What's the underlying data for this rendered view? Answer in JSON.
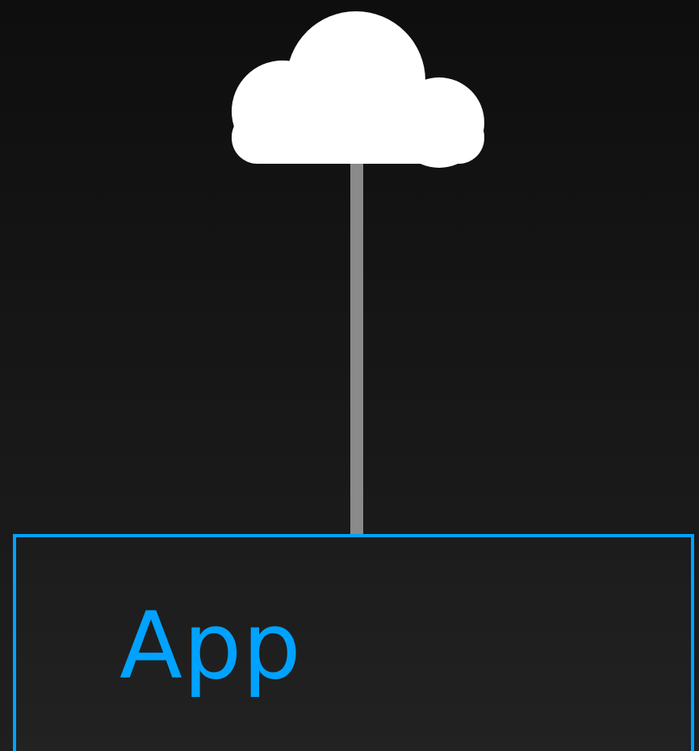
{
  "diagram": {
    "nodes": [
      {
        "id": "cloud",
        "icon": "cloud-icon",
        "label": ""
      },
      {
        "id": "app",
        "label": "App"
      }
    ],
    "edges": [
      {
        "from": "cloud",
        "to": "app"
      }
    ]
  },
  "colors": {
    "accent": "#00a2ff",
    "connector": "#8a8a8a",
    "cloud": "#ffffff",
    "background_top": "#0e0e0e",
    "background_bottom": "#1f1f1f"
  }
}
